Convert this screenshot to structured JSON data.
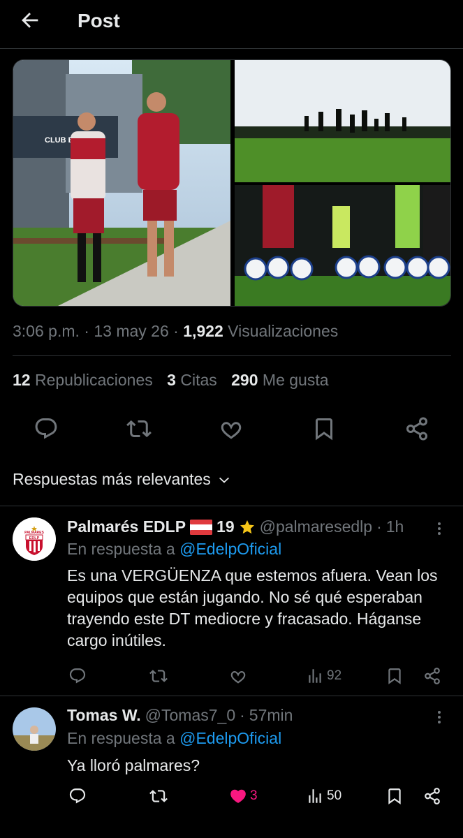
{
  "header": {
    "title": "Post"
  },
  "post": {
    "time": "3:06 p.m.",
    "date": "13 may 26",
    "views": "1,922",
    "views_label": "Visualizaciones",
    "reposts": "12",
    "reposts_label": "Republicaciones",
    "quotes": "3",
    "quotes_label": "Citas",
    "likes": "290",
    "likes_label": "Me gusta",
    "photo_sign_text": "CLUB ESTUD"
  },
  "sort": {
    "label": "Respuestas más relevantes"
  },
  "replies": [
    {
      "name": "Palmarés EDLP",
      "badge_text": "19",
      "handle": "@palmaresedlp",
      "time": "1h",
      "reply_to_prefix": "En respuesta a",
      "reply_to": "@EdelpOficial",
      "text": "Es una VERGÜENZA que estemos afuera. Vean los equipos que están jugando. No sé qué esperaban trayendo este DT mediocre y fracasado. Háganse cargo inútiles.",
      "likes": "",
      "views": "92",
      "avatar_logo_text": "EDLP",
      "avatar_logo_top": "PALMARES"
    },
    {
      "name": "Tomas W.",
      "handle": "@Tomas7_0",
      "time": "57min",
      "reply_to_prefix": "En respuesta a",
      "reply_to": "@EdelpOficial",
      "text": "Ya lloró palmares?",
      "likes": "3",
      "views": "50"
    }
  ],
  "colors": {
    "background": "#000000",
    "text": "#e7e9ea",
    "secondary": "#71767b",
    "link": "#1d9bf0",
    "like": "#f91880",
    "divider": "#2f3336"
  }
}
